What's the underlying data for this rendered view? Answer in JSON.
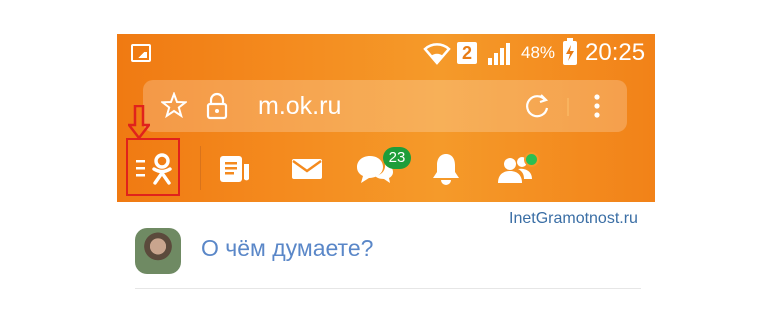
{
  "status_bar": {
    "sim_slot": "2",
    "battery_percent": "48%",
    "time": "20:25"
  },
  "browser": {
    "url": "m.ok.ru"
  },
  "toolbar": {
    "messages_badge": "23"
  },
  "content": {
    "watermark": "InetGramotnost.ru",
    "post_prompt": "О чём думаете?"
  },
  "colors": {
    "header_orange": "#f48a1e",
    "highlight_red": "#e0221c",
    "badge_green": "#1f9d3a",
    "prompt_blue": "#5a87c8"
  },
  "icons": [
    "image-icon",
    "wifi-icon",
    "signal-icon",
    "battery-icon",
    "star-icon",
    "lock-icon",
    "reload-icon",
    "more-icon",
    "ok-menu-icon",
    "feed-icon",
    "mail-icon",
    "discussions-icon",
    "bell-icon",
    "friends-icon",
    "down-arrow-icon"
  ]
}
